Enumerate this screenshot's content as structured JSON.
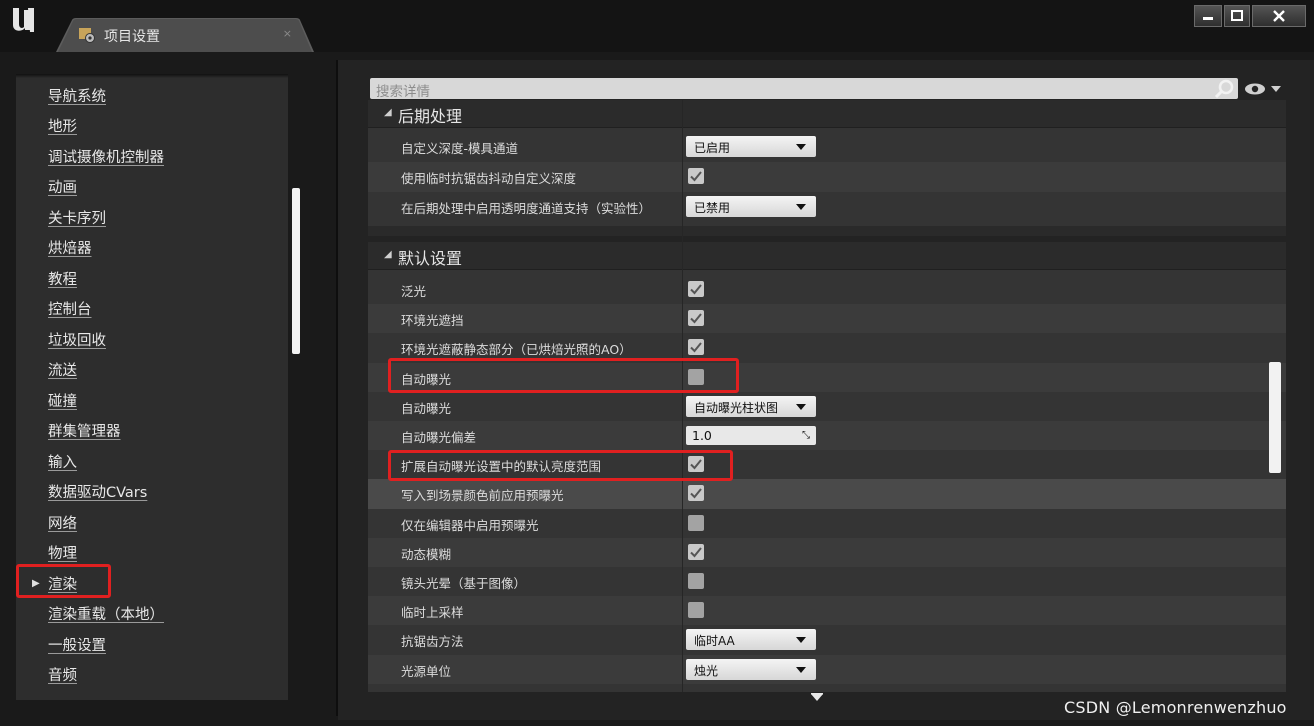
{
  "window": {
    "tab_title": "项目设置",
    "tab_close": "×",
    "buttons": {
      "minimize": "▬",
      "maximize": "□",
      "close": "✕"
    }
  },
  "sidebar": {
    "items": [
      {
        "label": "导航系统"
      },
      {
        "label": "地形"
      },
      {
        "label": "调试摄像机控制器"
      },
      {
        "label": "动画"
      },
      {
        "label": "关卡序列"
      },
      {
        "label": "烘焙器"
      },
      {
        "label": "教程"
      },
      {
        "label": "控制台"
      },
      {
        "label": "垃圾回收"
      },
      {
        "label": "流送"
      },
      {
        "label": "碰撞"
      },
      {
        "label": "群集管理器"
      },
      {
        "label": "输入"
      },
      {
        "label": "数据驱动CVars"
      },
      {
        "label": "网络"
      },
      {
        "label": "物理"
      },
      {
        "label": "渲染",
        "selected": true
      },
      {
        "label": "渲染重载（本地）"
      },
      {
        "label": "一般设置"
      },
      {
        "label": "音频"
      }
    ]
  },
  "search": {
    "placeholder": "搜索详情"
  },
  "sections": {
    "postprocess": {
      "title": "后期处理",
      "rows": [
        {
          "label": "自定义深度-模具通道",
          "type": "dropdown",
          "value": "已启用"
        },
        {
          "label": "使用临时抗锯齿抖动自定义深度",
          "type": "checkbox",
          "checked": true
        },
        {
          "label": "在后期处理中启用透明度通道支持（实验性）",
          "type": "dropdown",
          "value": "已禁用"
        }
      ]
    },
    "defaults": {
      "title": "默认设置",
      "rows": [
        {
          "label": "泛光",
          "type": "checkbox",
          "checked": true
        },
        {
          "label": "环境光遮挡",
          "type": "checkbox",
          "checked": true
        },
        {
          "label": "环境光遮蔽静态部分（已烘焙光照的AO）",
          "type": "checkbox",
          "checked": true
        },
        {
          "label": "自动曝光",
          "type": "checkbox",
          "checked": false
        },
        {
          "label": "自动曝光",
          "type": "dropdown",
          "value": "自动曝光柱状图"
        },
        {
          "label": "自动曝光偏差",
          "type": "number",
          "value": "1.0"
        },
        {
          "label": "扩展自动曝光设置中的默认亮度范围",
          "type": "checkbox",
          "checked": true
        },
        {
          "label": "写入到场景颜色前应用预曝光",
          "type": "checkbox",
          "checked": true
        },
        {
          "label": "仅在编辑器中启用预曝光",
          "type": "checkbox",
          "checked": false
        },
        {
          "label": "动态模糊",
          "type": "checkbox",
          "checked": true
        },
        {
          "label": "镜头光晕（基于图像）",
          "type": "checkbox",
          "checked": false
        },
        {
          "label": "临时上采样",
          "type": "checkbox",
          "checked": false
        },
        {
          "label": "抗锯齿方法",
          "type": "dropdown",
          "value": "临时AA"
        },
        {
          "label": "光源单位",
          "type": "dropdown",
          "value": "烛光"
        }
      ]
    }
  },
  "watermark": "CSDN @Lemonrenwenzhuo",
  "colors": {
    "highlight": "#e02020",
    "panel": "#343434",
    "background": "#151515"
  }
}
